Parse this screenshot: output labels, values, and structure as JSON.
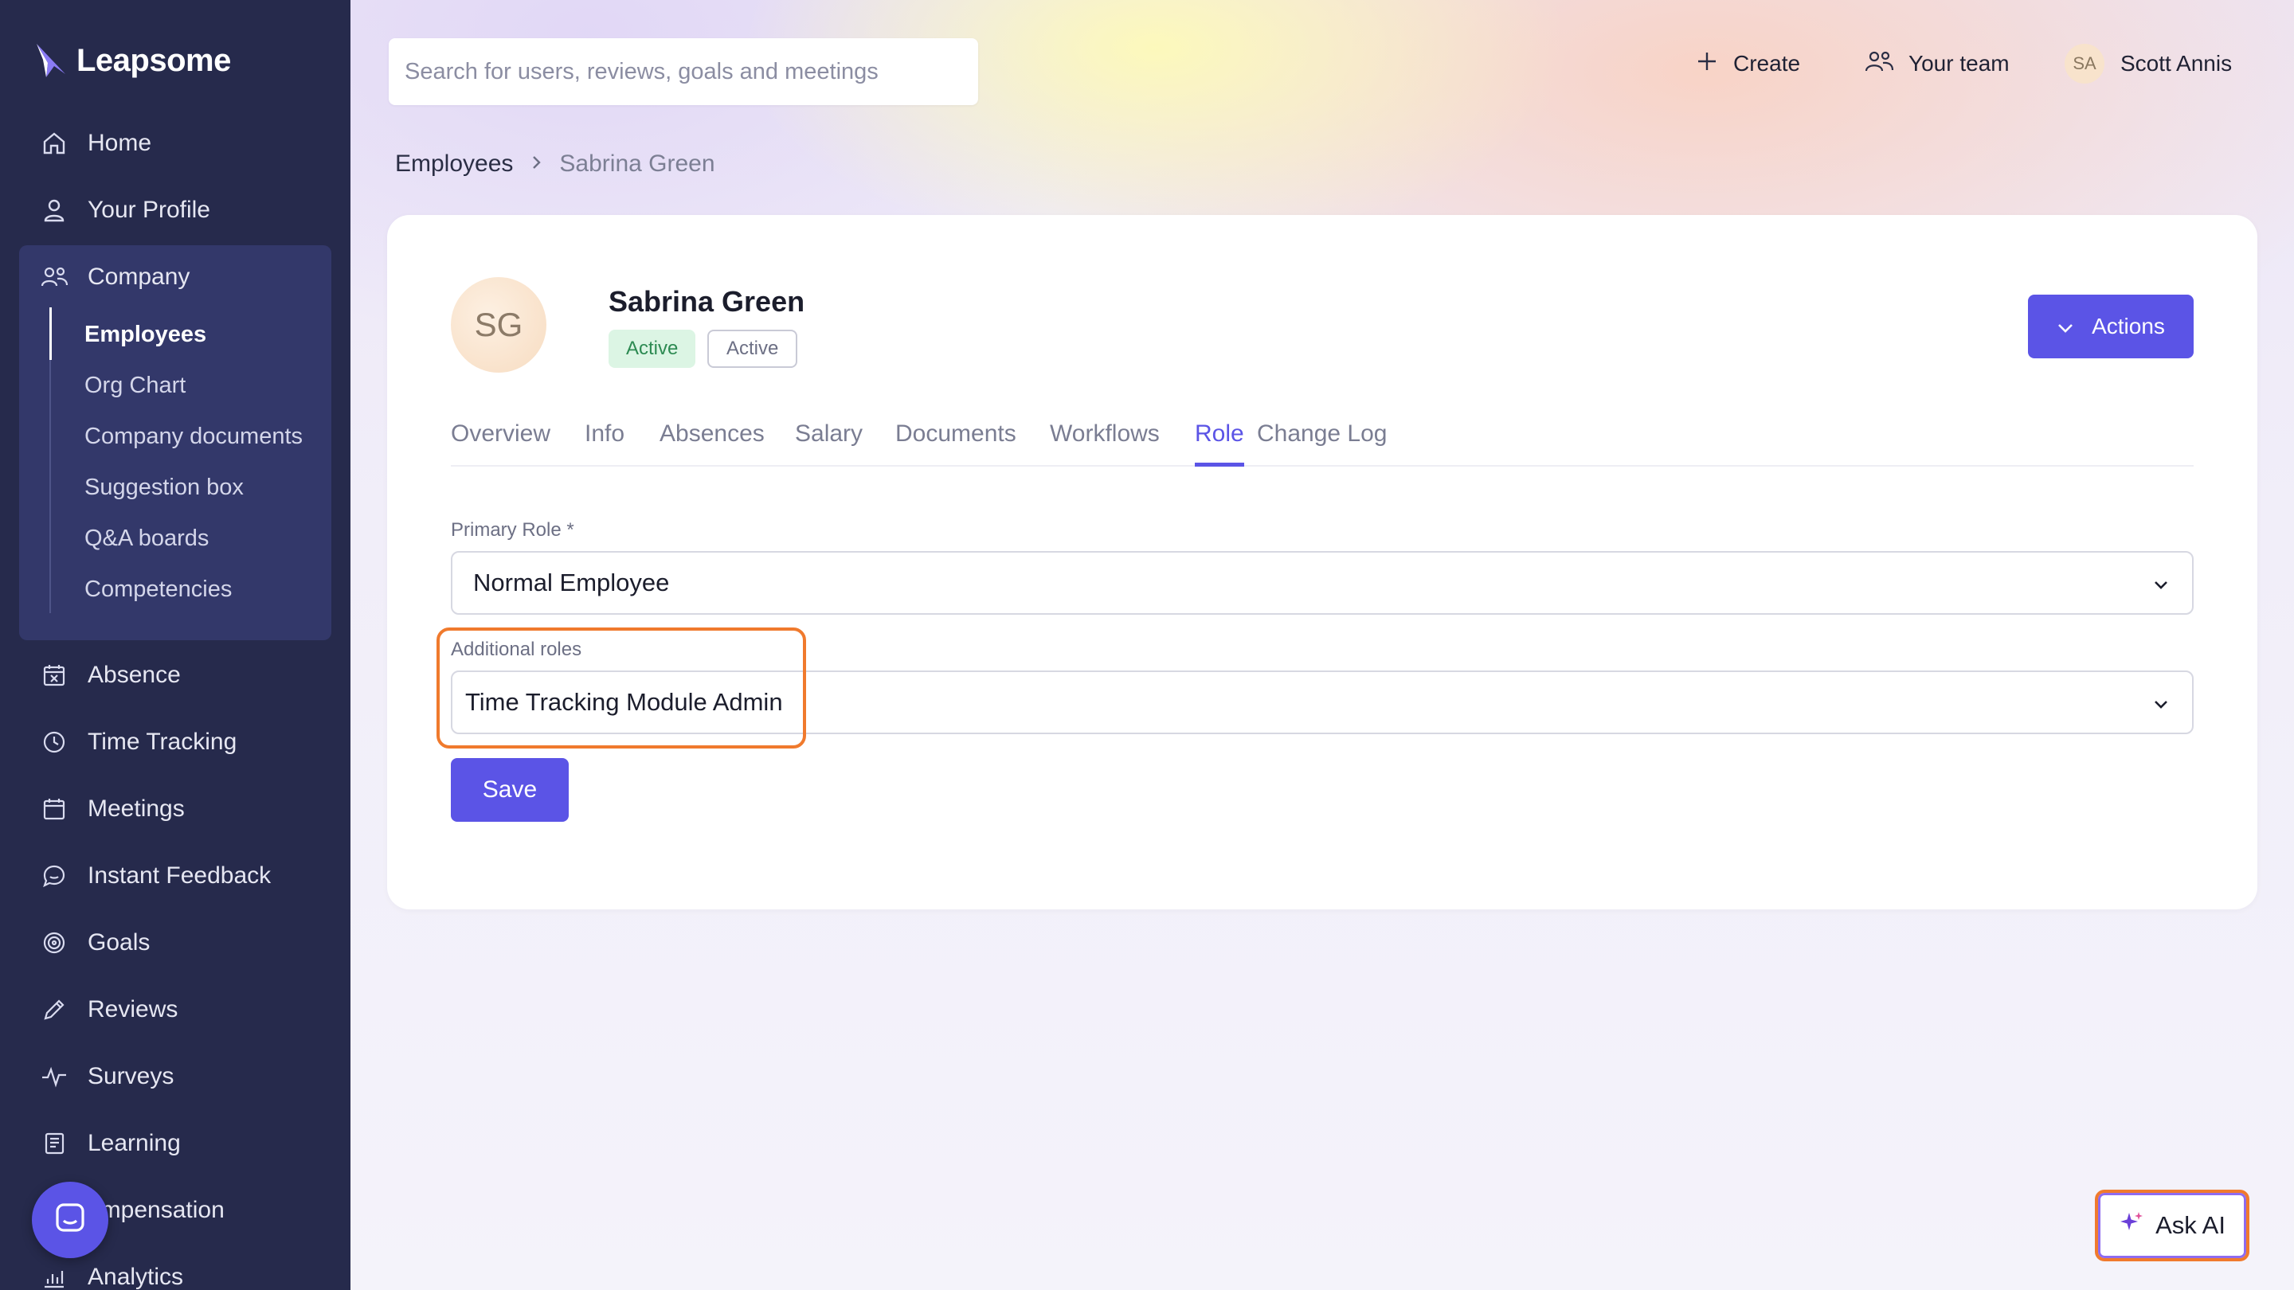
{
  "app": {
    "brand": "Leapsome",
    "accent_color": "#5b54e6",
    "sidebar_color": "#262a4c"
  },
  "sidebar": {
    "items": [
      {
        "label": "Home",
        "icon": "home-icon"
      },
      {
        "label": "Your Profile",
        "icon": "user-icon"
      },
      {
        "label": "Company",
        "icon": "users-icon"
      },
      {
        "label": "Absence",
        "icon": "calendar-x-icon"
      },
      {
        "label": "Time Tracking",
        "icon": "clock-icon"
      },
      {
        "label": "Meetings",
        "icon": "calendar-icon"
      },
      {
        "label": "Instant Feedback",
        "icon": "chat-icon"
      },
      {
        "label": "Goals",
        "icon": "target-icon"
      },
      {
        "label": "Reviews",
        "icon": "pencil-icon"
      },
      {
        "label": "Surveys",
        "icon": "pulse-icon"
      },
      {
        "label": "Learning",
        "icon": "book-icon"
      },
      {
        "label": "ompensation",
        "icon": "coins-icon"
      },
      {
        "label": "Analytics",
        "icon": "chart-icon"
      }
    ],
    "company_subitems": [
      {
        "label": "Employees",
        "active": true
      },
      {
        "label": "Org Chart"
      },
      {
        "label": "Company documents"
      },
      {
        "label": "Suggestion box"
      },
      {
        "label": "Q&A boards"
      },
      {
        "label": "Competencies"
      }
    ]
  },
  "header": {
    "search_placeholder": "Search for users, reviews, goals and meetings",
    "create_label": "Create",
    "team_label": "Your team",
    "user_initials": "SA",
    "user_name": "Scott Annis"
  },
  "breadcrumb": {
    "parent": "Employees",
    "current": "Sabrina Green"
  },
  "employee": {
    "initials": "SG",
    "name": "Sabrina Green",
    "status_badge": "Active",
    "status_badge_2": "Active",
    "actions_label": "Actions"
  },
  "tabs": [
    {
      "label": "Overview"
    },
    {
      "label": "Info"
    },
    {
      "label": "Absences"
    },
    {
      "label": "Salary"
    },
    {
      "label": "Documents"
    },
    {
      "label": "Workflows"
    },
    {
      "label": "Role",
      "active": true
    },
    {
      "label": "Change Log"
    }
  ],
  "role_form": {
    "primary_role_label": "Primary Role *",
    "primary_role_value": "Normal Employee",
    "additional_roles_label": "Additional roles",
    "additional_roles_value": "Time Tracking Module Admin",
    "save_label": "Save"
  },
  "ask_ai_label": "Ask AI"
}
